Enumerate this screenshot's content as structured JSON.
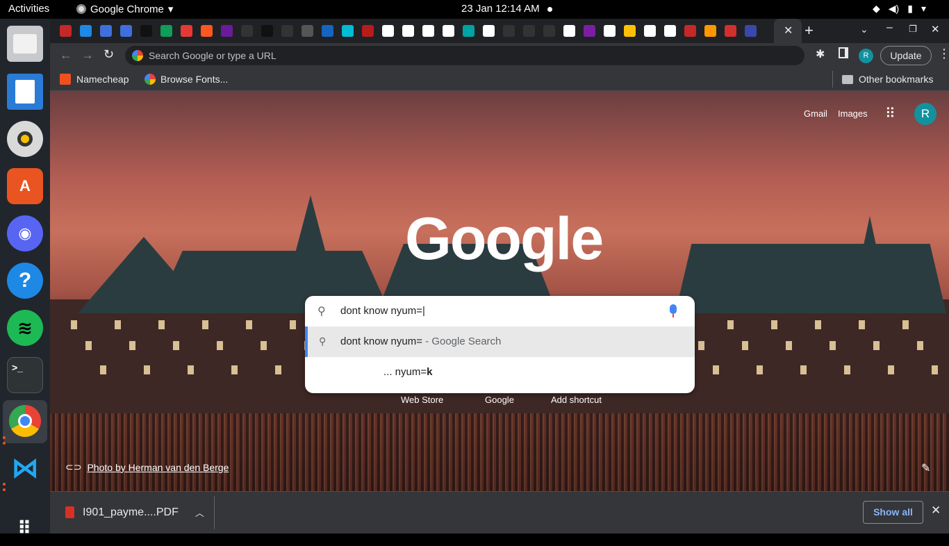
{
  "topbar": {
    "activities": "Activities",
    "app_name": "Google Chrome",
    "clock": "23 Jan  12:14 AM"
  },
  "dock": {
    "items": [
      "files-icon",
      "writer-icon",
      "rhythmbox-icon",
      "software-icon",
      "discord-icon",
      "help-icon",
      "spotify-icon",
      "terminal-icon",
      "chrome-icon",
      "vscode-icon",
      "apps-grid-icon"
    ]
  },
  "tabs": {
    "favicon_colors": [
      "#c62828",
      "#1e88e5",
      "#3f6fdc",
      "#3f6fdc",
      "#111111",
      "#0f9d58",
      "#e53935",
      "#ff5722",
      "#6a1b9a",
      "#333333",
      "#111111",
      "#333333",
      "#555555",
      "#1565c0",
      "#00bcd4",
      "#b71c1c",
      "#ffffff",
      "#ffffff",
      "#ffffff",
      "#ffffff",
      "#00a3a3",
      "#ffffff",
      "#333333",
      "#333333",
      "#333333",
      "#ffffff",
      "#7b1fa2",
      "#ffffff",
      "#ffc107",
      "#ffffff",
      "#ffffff",
      "#c62828",
      "#ff9800",
      "#d32f2f",
      "#3949ab"
    ]
  },
  "toolbar": {
    "omnibox_placeholder": "Search Google or type a URL",
    "update_label": "Update",
    "profile_initial": "R"
  },
  "bookmarks": {
    "items": [
      {
        "label": "Namecheap"
      },
      {
        "label": "Browse Fonts..."
      }
    ],
    "other_label": "Other bookmarks"
  },
  "ntp": {
    "links": {
      "gmail": "Gmail",
      "images": "Images"
    },
    "profile_initial": "R",
    "logo": "Google",
    "search_value": "dont know nyum=",
    "suggestions": [
      {
        "text": "dont know nyum=",
        "suffix": " - Google Search"
      },
      {
        "text": "... nyum=",
        "bold": "k"
      }
    ],
    "shortcuts": [
      "Web Store",
      "Google",
      "Add shortcut"
    ],
    "photo_credit": "Photo by Herman van den Berge"
  },
  "downloads": {
    "file": "I901_payme....PDF",
    "show_all": "Show all"
  }
}
